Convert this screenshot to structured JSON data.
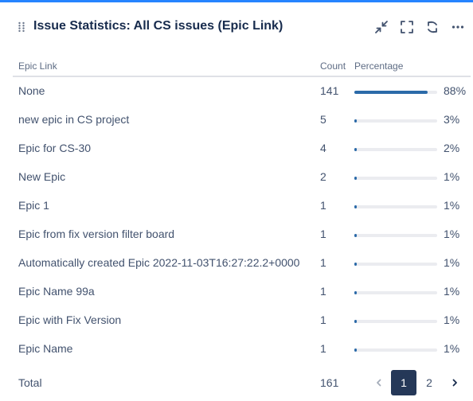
{
  "header": {
    "title": "Issue Statistics: All CS issues (Epic Link)",
    "icons": [
      "drag-handle-icon",
      "minimize-icon",
      "fullscreen-icon",
      "refresh-icon",
      "more-icon"
    ]
  },
  "table": {
    "columns": {
      "name": "Epic Link",
      "count": "Count",
      "percentage": "Percentage"
    },
    "rows": [
      {
        "name": "None",
        "count": "141",
        "pct": "88%",
        "fraction": 0.88
      },
      {
        "name": "new epic in CS project",
        "count": "5",
        "pct": "3%",
        "fraction": 0.03
      },
      {
        "name": "Epic for CS-30",
        "count": "4",
        "pct": "2%",
        "fraction": 0.02
      },
      {
        "name": "New Epic",
        "count": "2",
        "pct": "1%",
        "fraction": 0.01
      },
      {
        "name": "Epic 1",
        "count": "1",
        "pct": "1%",
        "fraction": 0.01
      },
      {
        "name": "Epic from fix version filter board",
        "count": "1",
        "pct": "1%",
        "fraction": 0.01
      },
      {
        "name": "Automatically created Epic 2022-11-03T16:27:22.2+0000",
        "count": "1",
        "pct": "1%",
        "fraction": 0.01
      },
      {
        "name": "Epic Name 99a",
        "count": "1",
        "pct": "1%",
        "fraction": 0.01
      },
      {
        "name": "Epic with Fix Version",
        "count": "1",
        "pct": "1%",
        "fraction": 0.01
      },
      {
        "name": "Epic Name",
        "count": "1",
        "pct": "1%",
        "fraction": 0.01
      }
    ]
  },
  "footer": {
    "total_label": "Total",
    "total_count": "161",
    "pagination": {
      "pages": [
        "1",
        "2"
      ],
      "current": "1"
    }
  },
  "colors": {
    "accent": "#2684ff",
    "bar": "#2b6aa8",
    "track": "#ebecf0",
    "active_page": "#253858"
  }
}
